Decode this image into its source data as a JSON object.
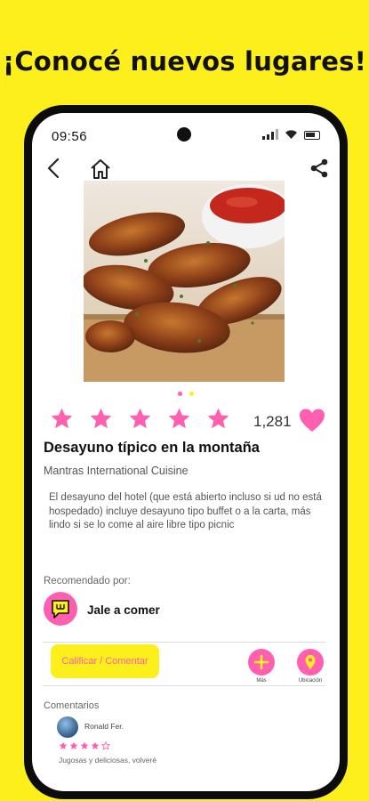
{
  "headline": "¡Conocé nuevos lugares!",
  "status_bar": {
    "time": "09:56"
  },
  "place": {
    "title": "Desayuno típico en la montaña",
    "restaurant": "Mantras International Cuisine",
    "description": "El desayuno del hotel (que está abierto incluso si ud no está hospedado) incluye desayuno tipo buffet o a la carta, más lindo si se lo come al aire libre tipo picnic",
    "rating_stars": 5,
    "likes": "1,281"
  },
  "gallery": {
    "image_count": 2,
    "active_index": 0
  },
  "recommended": {
    "label": "Recomendado por:",
    "name": "Jale a comer"
  },
  "actions": {
    "rate_button": "Calificar / Comentar",
    "more_label": "Más",
    "location_label": "Ubicación"
  },
  "comments": {
    "label": "Comentarios",
    "items": [
      {
        "user": "Ronald Fer.",
        "stars": 4,
        "max_stars": 5,
        "text": "Jugosas y deliciosas, volveré"
      }
    ]
  },
  "icons": [
    "back-arrow-icon",
    "home-icon",
    "share-icon",
    "star-icon",
    "heart-icon",
    "plus-icon",
    "location-pin-icon",
    "chat-bubble-logo"
  ],
  "colors": {
    "brand_yellow": "#FDEF1C",
    "accent_pink": "#FF5FB0"
  }
}
